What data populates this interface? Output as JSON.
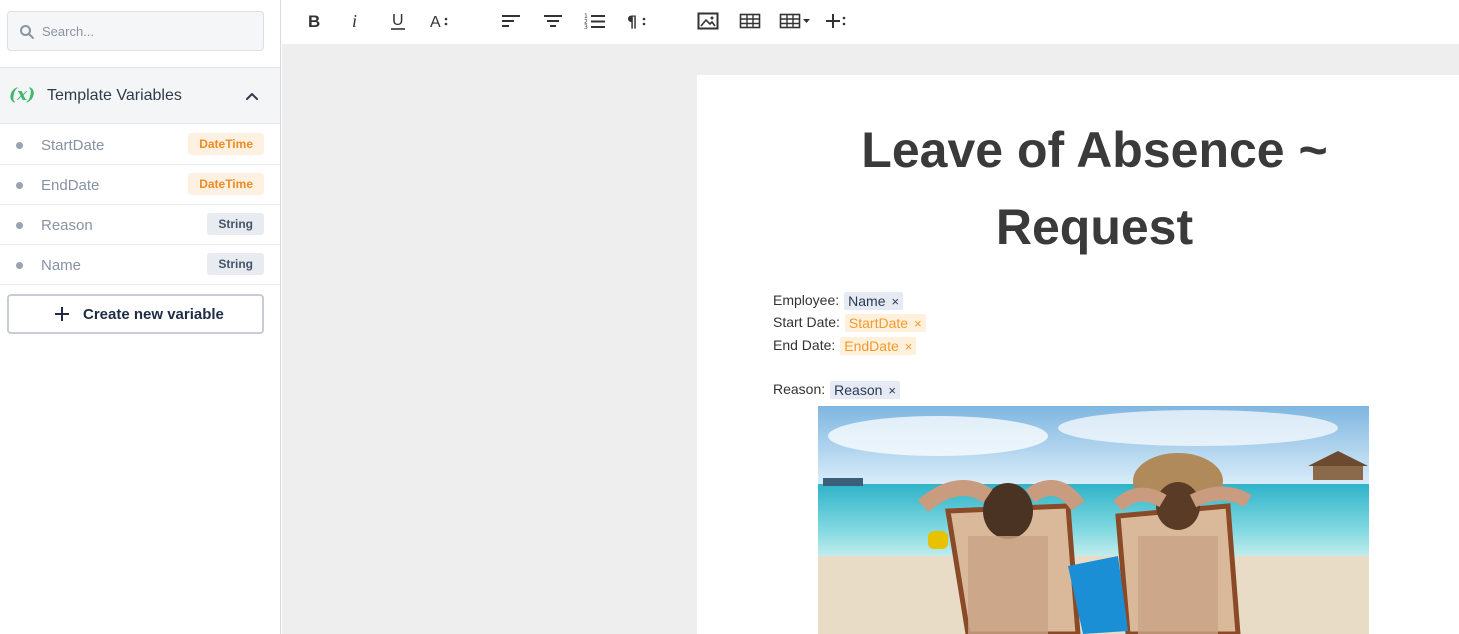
{
  "sidebar": {
    "search": {
      "placeholder": "Search..."
    },
    "section": {
      "title": "Template Variables",
      "icon": "x-variable-icon"
    },
    "variables": [
      {
        "name": "StartDate",
        "type": "DateTime"
      },
      {
        "name": "EndDate",
        "type": "DateTime"
      },
      {
        "name": "Reason",
        "type": "String"
      },
      {
        "name": "Name",
        "type": "String"
      }
    ],
    "create_label": "Create new variable"
  },
  "toolbar": {
    "buttons": [
      "bold-icon",
      "italic-icon",
      "underline-icon",
      "font-size-icon",
      "align-left-icon",
      "align-center-icon",
      "numbered-list-icon",
      "paragraph-icon",
      "image-icon",
      "table-icon",
      "table-dropdown-icon",
      "insert-field-icon"
    ]
  },
  "document": {
    "title_line1": "Leave of Absence ~",
    "title_line2": "Request",
    "fields": [
      {
        "label": "Employee:",
        "chip": "Name",
        "kind": "String"
      },
      {
        "label": "Start Date:",
        "chip": "StartDate",
        "kind": "DateTime"
      },
      {
        "label": "End Date:",
        "chip": "EndDate",
        "kind": "DateTime"
      },
      {
        "label": "Reason:",
        "chip": "Reason",
        "kind": "String"
      }
    ],
    "chip_remove": "×"
  },
  "colors": {
    "datetime_text": "#f08a24",
    "datetime_bg": "#fff1e1",
    "string_bg": "#e8ebf0",
    "accent_green": "#3fb86b"
  }
}
